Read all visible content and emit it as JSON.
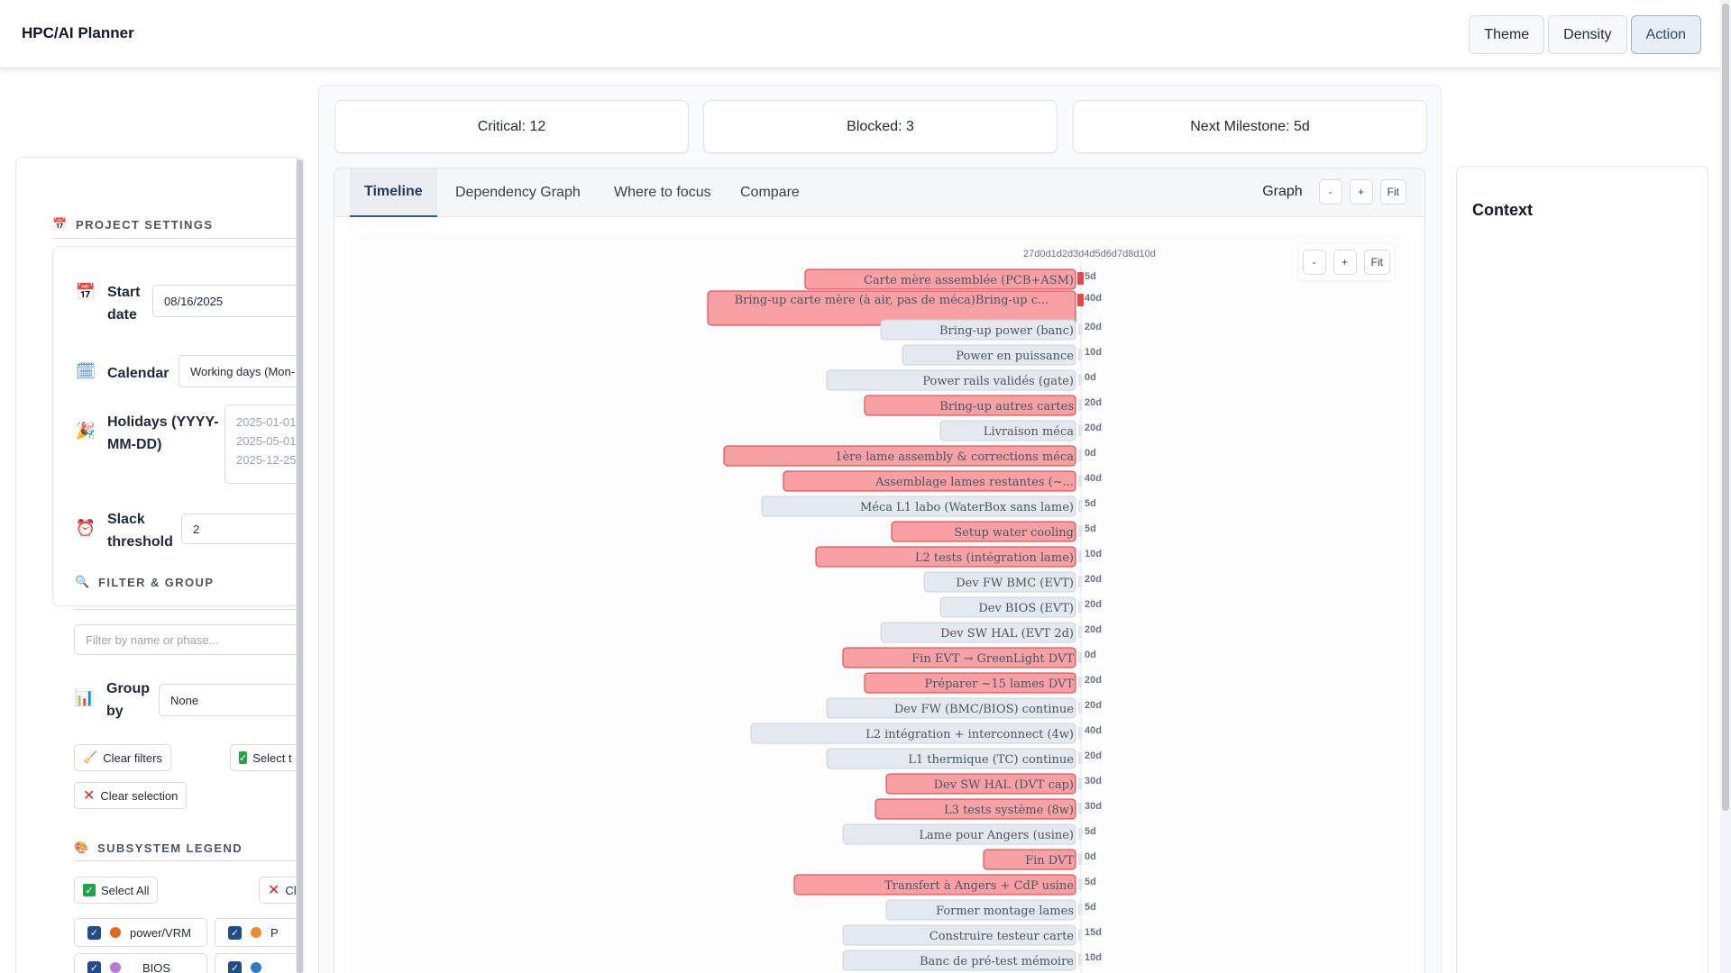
{
  "app": {
    "title": "HPC/AI Planner"
  },
  "topbar": {
    "buttons": [
      "Theme",
      "Density",
      "Action"
    ]
  },
  "sidebar": {
    "project_settings": {
      "title": "PROJECT SETTINGS",
      "start_date_label": "Start date",
      "start_date_value": "08/16/2025",
      "calendar_label": "Calendar",
      "calendar_value": "Working days (Mon-",
      "holidays_label": "Holidays (YYYY-MM-DD)",
      "holidays_value": "2025-01-01,\n2025-05-01,\n2025-12-25",
      "slack_label": "Slack threshold",
      "slack_value": "2"
    },
    "filter_group": {
      "title": "FILTER & GROUP",
      "filter_placeholder": "Filter by name or phase...",
      "group_by_label": "Group by",
      "group_by_value": "None",
      "clear_filters": "Clear filters",
      "select_critical": "Select t",
      "clear_selection": "Clear selection"
    },
    "subsystem_legend": {
      "title": "SUBSYSTEM LEGEND",
      "select_all": "Select All",
      "clear_all": "Cl",
      "items": [
        {
          "label": "power/VRM",
          "color": "#e06a1f"
        },
        {
          "label": "P",
          "color": "#f28a2e"
        },
        {
          "label": "BIOS",
          "color": "#b57ad6"
        },
        {
          "label": "",
          "color": "#2f79c9"
        }
      ]
    }
  },
  "stats": {
    "critical": "Critical: 12",
    "blocked": "Blocked: 3",
    "next_milestone": "Next Milestone: 5d"
  },
  "tabs": [
    "Timeline",
    "Dependency Graph",
    "Where to focus",
    "Compare"
  ],
  "graph_controls": {
    "label": "Graph",
    "minus": "-",
    "plus": "+",
    "fit": "Fit"
  },
  "canvas_controls": {
    "minus": "-",
    "plus": "+",
    "fit": "Fit"
  },
  "context": {
    "title": "Context"
  },
  "chart_data": {
    "type": "gantt",
    "axis_top_label": "27d0d1d2d3d4d5d6d7d8d10d",
    "colors": {
      "critical_fill": "#f7a1a4",
      "critical_stroke": "#d9363e",
      "normal_fill": "#e4e8ef",
      "normal_stroke": "#cdd3dc"
    },
    "tasks": [
      {
        "name": "Carte mère assemblée (PCB+ASM)",
        "critical": true,
        "duration": 25,
        "label": "5d"
      },
      {
        "name": "Bring-up carte mère (à air, pas de méca)Bring-up c...",
        "critical": true,
        "duration": 34,
        "label": "40d",
        "two_line": true
      },
      {
        "name": "Bring-up power (banc)",
        "critical": false,
        "duration": 18,
        "label": "20d"
      },
      {
        "name": "Power en puissance",
        "critical": false,
        "duration": 16,
        "label": "10d"
      },
      {
        "name": "Power rails validés (gate)",
        "critical": false,
        "duration": 23,
        "label": "0d"
      },
      {
        "name": "Bring-up autres cartes",
        "critical": true,
        "duration": 19.5,
        "label": "20d"
      },
      {
        "name": "Livraison méca",
        "critical": false,
        "duration": 12.5,
        "label": "20d"
      },
      {
        "name": "1ère lame assembly & corrections méca",
        "critical": true,
        "duration": 32.5,
        "label": "0d"
      },
      {
        "name": "Assemblage lames restantes (~...",
        "critical": true,
        "duration": 27,
        "label": "40d"
      },
      {
        "name": "Méca L1 labo (WaterBox sans lame)",
        "critical": false,
        "duration": 29,
        "label": "5d"
      },
      {
        "name": "Setup water cooling",
        "critical": true,
        "duration": 17,
        "label": "5d"
      },
      {
        "name": "L2 tests (intégration lame)",
        "critical": true,
        "duration": 24,
        "label": "10d"
      },
      {
        "name": "Dev FW BMC (EVT)",
        "critical": false,
        "duration": 14,
        "label": "20d"
      },
      {
        "name": "Dev BIOS (EVT)",
        "critical": false,
        "duration": 12.5,
        "label": "20d"
      },
      {
        "name": "Dev SW HAL (EVT 2d)",
        "critical": false,
        "duration": 18,
        "label": "20d"
      },
      {
        "name": "Fin EVT → GreenLight DVT",
        "critical": true,
        "duration": 21.5,
        "label": "0d"
      },
      {
        "name": "Préparer ~15 lames DVT",
        "critical": true,
        "duration": 19.5,
        "label": "20d"
      },
      {
        "name": "Dev FW (BMC/BIOS) continue",
        "critical": false,
        "duration": 23,
        "label": "20d"
      },
      {
        "name": "L2 intégration + interconnect (4w)",
        "critical": false,
        "duration": 30,
        "label": "40d"
      },
      {
        "name": "L1 thermique (TC) continue",
        "critical": false,
        "duration": 23,
        "label": "20d"
      },
      {
        "name": "Dev SW HAL (DVT cap)",
        "critical": true,
        "duration": 17.5,
        "label": "30d"
      },
      {
        "name": "L3 tests système (8w)",
        "critical": true,
        "duration": 18.5,
        "label": "30d"
      },
      {
        "name": "Lame pour Angers (usine)",
        "critical": false,
        "duration": 21.5,
        "label": "5d"
      },
      {
        "name": "Fin DVT",
        "critical": true,
        "duration": 8.5,
        "label": "0d"
      },
      {
        "name": "Transfert à Angers + CdP usine",
        "critical": true,
        "duration": 26,
        "label": "5d"
      },
      {
        "name": "Former montage lames",
        "critical": false,
        "duration": 17.5,
        "label": "5d"
      },
      {
        "name": "Construire testeur carte",
        "critical": false,
        "duration": 21.5,
        "label": "15d"
      },
      {
        "name": "Banc de pré-test mémoire",
        "critical": false,
        "duration": 21.5,
        "label": "10d"
      }
    ]
  }
}
